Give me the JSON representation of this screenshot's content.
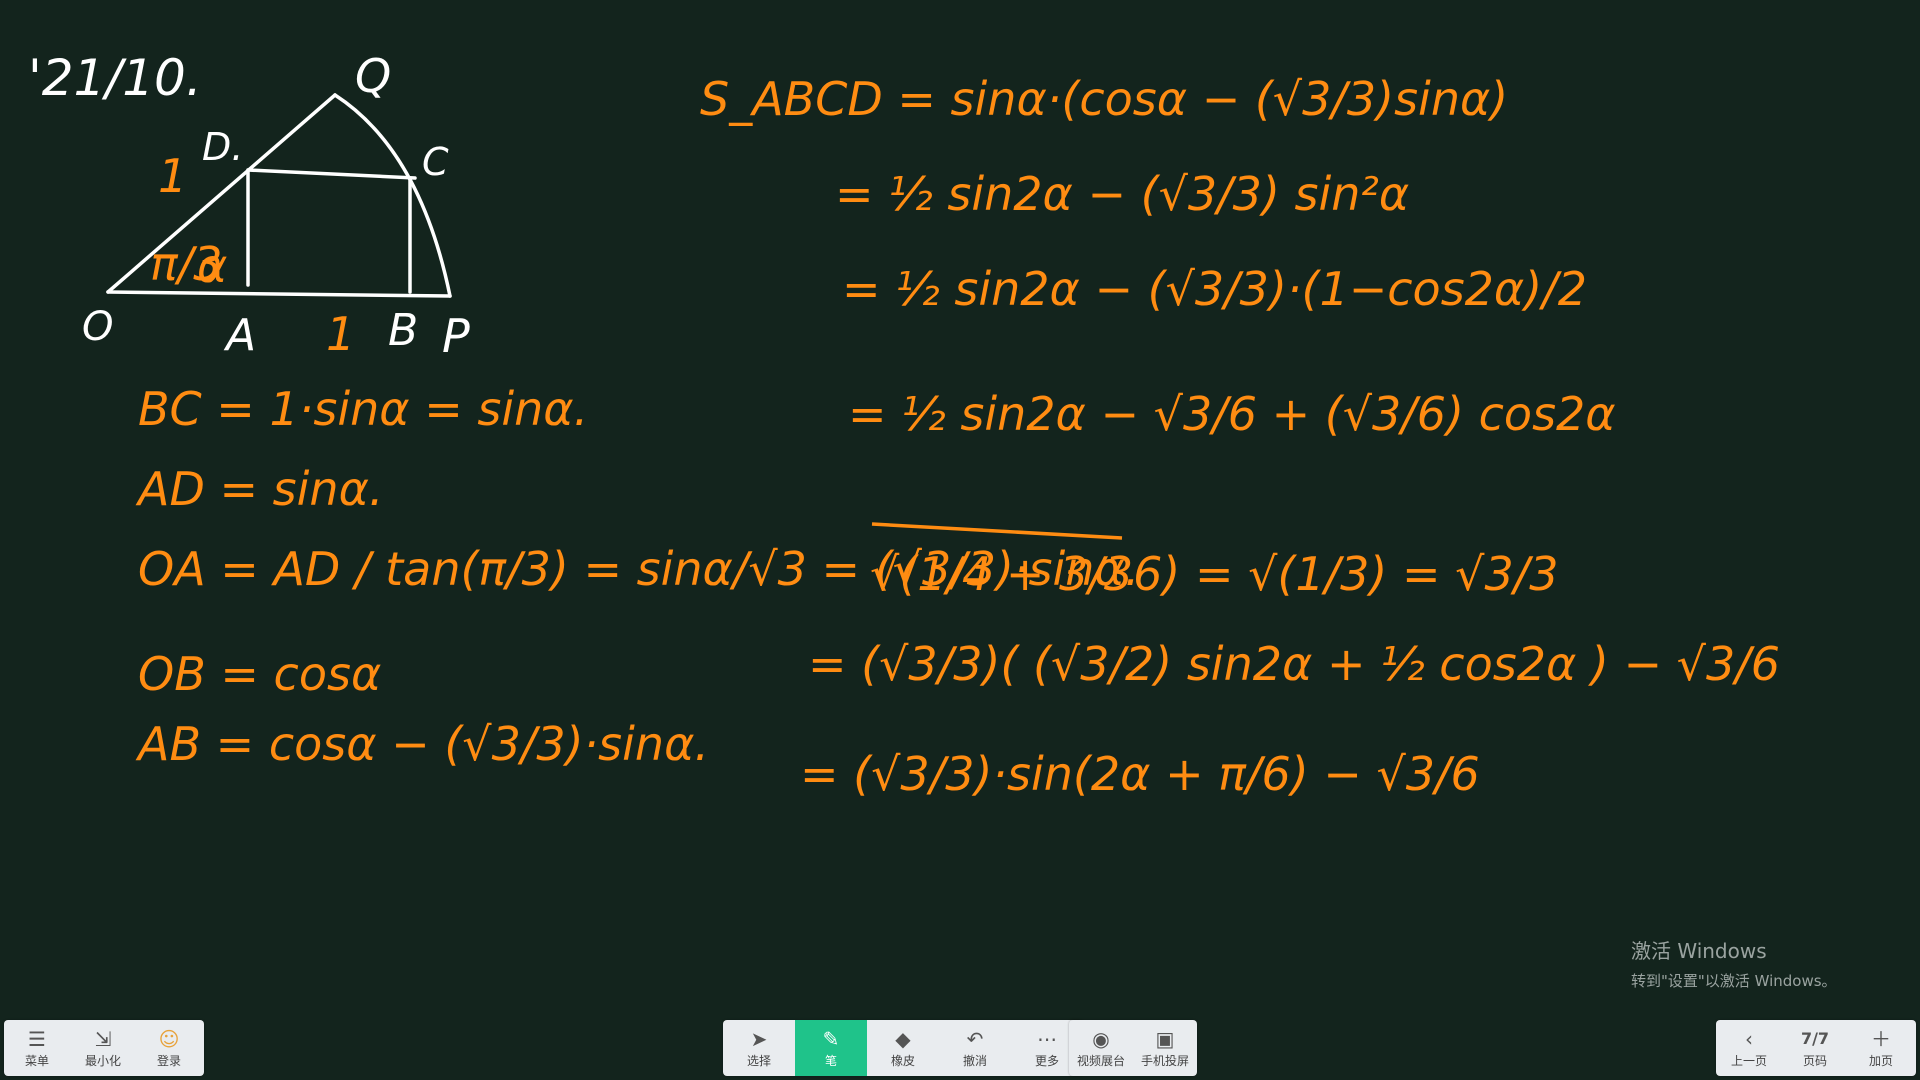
{
  "board": {
    "title_note": "'21/10.",
    "diagram_labels": {
      "Q": "Q",
      "D": "D.",
      "C": "C",
      "O": "O",
      "A": "A",
      "B": "B",
      "P": "P",
      "one_left": "1",
      "one_bottom": "1",
      "angle": "π/3",
      "alpha": "α"
    },
    "left_work": [
      "BC = 1·sinα = sinα.",
      "AD = sinα.",
      "OA = AD / tan(π/3) = sinα/√3 = (√3/3)·sinα.",
      "OB = cosα",
      "AB = cosα − (√3/3)·sinα."
    ],
    "right_work": [
      "S_ABCD = sinα·(cosα − (√3/3)sinα)",
      "= ½ sin2α − (√3/3) sin²α",
      "= ½ sin2α − (√3/3)·(1−cos2α)/2",
      "= ½ sin2α − √3/6 + (√3/6) cos2α",
      "√(1/4 + 3/36) = √(1/3) = √3/3",
      "= (√3/3)( (√3/2) sin2α + ½ cos2α ) − √3/6",
      "= (√3/3)·sin(2α + π/6) − √3/6"
    ]
  },
  "toolbar_left": [
    {
      "label": "菜单",
      "icon": "menu-icon"
    },
    {
      "label": "最小化",
      "icon": "minimize-icon"
    },
    {
      "label": "登录",
      "icon": "avatar-icon"
    }
  ],
  "toolbar_center": [
    {
      "label": "选择",
      "icon": "cursor-icon"
    },
    {
      "label": "笔",
      "icon": "pen-icon",
      "active": true
    },
    {
      "label": "橡皮",
      "icon": "eraser-icon"
    },
    {
      "label": "撤消",
      "icon": "undo-icon"
    },
    {
      "label": "更多",
      "icon": "more-icon"
    }
  ],
  "toolbar_media": [
    {
      "label": "视频展台",
      "icon": "camera-icon"
    },
    {
      "label": "手机投屏",
      "icon": "phone-cast-icon"
    }
  ],
  "toolbar_right": [
    {
      "label": "上一页",
      "icon": "chevron-left-icon"
    },
    {
      "label": "页码",
      "value": "7/7"
    },
    {
      "label": "加页",
      "icon": "plus-icon"
    }
  ],
  "watermark": {
    "line1": "激活 Windows",
    "line2": "转到\"设置\"以激活 Windows。"
  },
  "colors": {
    "board_bg": "#13241d",
    "ink_orange": "#ff8c12",
    "ink_white": "#ffffff",
    "active_green": "#1fc38a"
  }
}
